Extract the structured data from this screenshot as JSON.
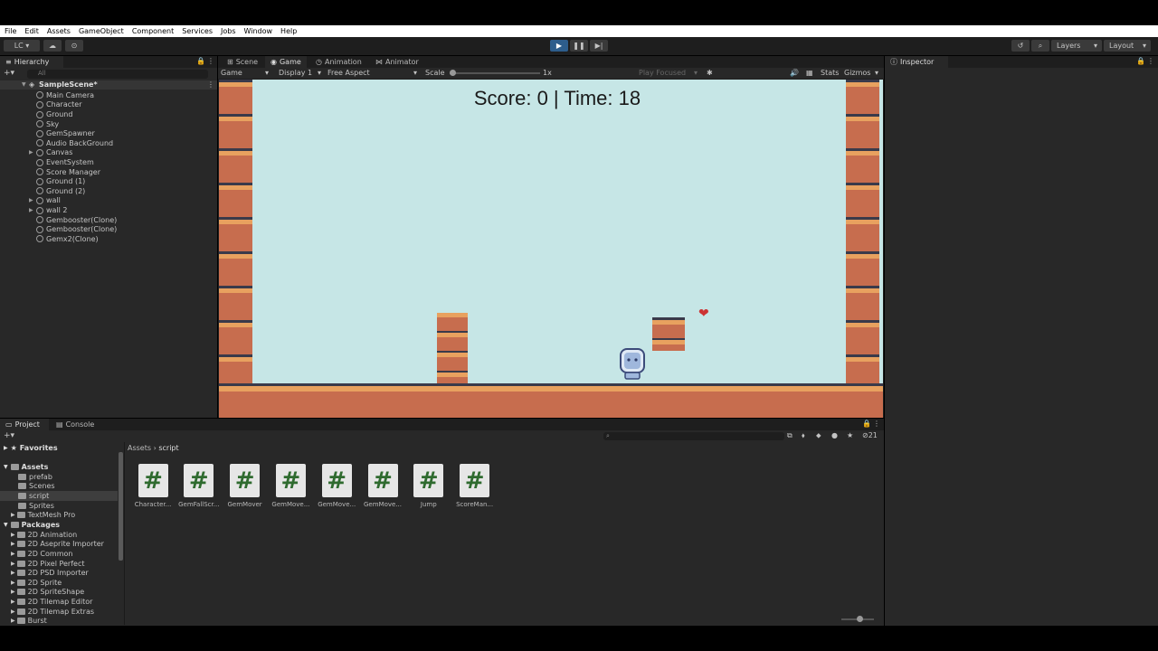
{
  "menu": [
    "File",
    "Edit",
    "Assets",
    "GameObject",
    "Component",
    "Services",
    "Jobs",
    "Window",
    "Help"
  ],
  "toolbar": {
    "account": "LC ▾",
    "layers": "Layers",
    "layout": "Layout"
  },
  "hierarchy": {
    "tab": "Hierarchy",
    "search_placeholder": "All",
    "scene": "SampleScene*",
    "items": [
      "Main Camera",
      "Character",
      "Ground",
      "Sky",
      "GemSpawner",
      "Audio BackGround",
      "Canvas",
      "EventSystem",
      "Score Manager",
      "Ground (1)",
      "Ground (2)",
      "wall",
      "wall 2",
      "Gembooster(Clone)",
      "Gembooster(Clone)",
      "Gemx2(Clone)"
    ]
  },
  "game": {
    "tabs": [
      "Scene",
      "Game",
      "Animation",
      "Animator"
    ],
    "mode": "Game",
    "display": "Display 1",
    "aspect": "Free Aspect",
    "scale_label": "Scale",
    "scale_value": "1x",
    "play_focused": "Play Focused",
    "stats": "Stats",
    "gizmos": "Gizmos",
    "hud": "Score: 0 | Time: 18"
  },
  "inspector": {
    "tab": "Inspector"
  },
  "project": {
    "tabs": [
      "Project",
      "Console"
    ],
    "favorites": "Favorites",
    "assets_root": "Assets",
    "asset_folders": [
      "prefab",
      "Scenes",
      "script",
      "Sprites",
      "TextMesh Pro"
    ],
    "packages_root": "Packages",
    "packages": [
      "2D Animation",
      "2D Aseprite Importer",
      "2D Common",
      "2D Pixel Perfect",
      "2D PSD Importer",
      "2D Sprite",
      "2D SpriteShape",
      "2D Tilemap Editor",
      "2D Tilemap Extras",
      "Burst"
    ],
    "breadcrumb": [
      "Assets",
      "script"
    ],
    "hidden_count": "21",
    "files": [
      "Character...",
      "GemFallScr...",
      "GemMover",
      "GemMove...",
      "GemMove...",
      "GemMove...",
      "Jump",
      "ScoreMan..."
    ]
  }
}
